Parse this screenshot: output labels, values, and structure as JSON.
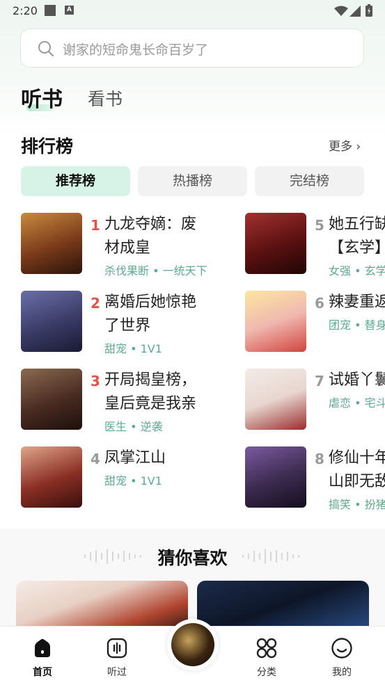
{
  "status": {
    "time": "2:20",
    "notification_badge": "A"
  },
  "search": {
    "placeholder": "谢家的短命鬼长命百岁了"
  },
  "top_tabs": [
    {
      "label": "听书",
      "active": true
    },
    {
      "label": "看书",
      "active": false
    }
  ],
  "ranking": {
    "title": "排行榜",
    "more": "更多 ›",
    "tabs": [
      {
        "label": "推荐榜",
        "active": true
      },
      {
        "label": "热播榜",
        "active": false
      },
      {
        "label": "完结榜",
        "active": false
      }
    ],
    "books": [
      {
        "rank": "1",
        "title_line1": "九龙夺嫡：废",
        "title_line2": "材成皇",
        "tags": "杀伐果断 • 一统天下",
        "cover_color": "#7a3a1a"
      },
      {
        "rank": "2",
        "title_line1": "离婚后她惊艳",
        "title_line2": "了世界",
        "tags": "甜宠 • 1V1",
        "cover_color": "#3a3b66"
      },
      {
        "rank": "3",
        "title_line1": "开局揭皇榜，",
        "title_line2": "皇后竟是我亲",
        "tags": "医生 • 逆袭",
        "cover_color": "#4a2b22"
      },
      {
        "rank": "4",
        "title_line1": "凤掌江山",
        "title_line2": "",
        "tags": "甜宠 • 1V1",
        "cover_color": "#8a2f24"
      },
      {
        "rank": "5",
        "title_line1": "她五行缺",
        "title_line2": "【玄学】",
        "tags": "女强 • 玄学",
        "cover_color": "#5a1010"
      },
      {
        "rank": "6",
        "title_line1": "辣妻重返",
        "title_line2": "",
        "tags": "团宠 • 替身",
        "cover_color": "#f0b9b0"
      },
      {
        "rank": "7",
        "title_line1": "试婚丫鬟",
        "title_line2": "",
        "tags": "虐恋 • 宅斗",
        "cover_color": "#e8d6cf"
      },
      {
        "rank": "8",
        "title_line1": "修仙十年",
        "title_line2": "山即无敌",
        "tags": "搞笑 • 扮猪",
        "cover_color": "#3b2a4e"
      }
    ],
    "rank_colors": {
      "top3": "#e4524d",
      "rest": "#9a9a9a"
    }
  },
  "guess": {
    "title": "猜你喜欢"
  },
  "bottom_nav": [
    {
      "label": "首页",
      "icon": "home-icon",
      "active": true
    },
    {
      "label": "听过",
      "icon": "history-icon",
      "active": false
    },
    {
      "label": "",
      "icon": "player-disc-icon",
      "active": false
    },
    {
      "label": "分类",
      "icon": "category-icon",
      "active": false
    },
    {
      "label": "我的",
      "icon": "profile-icon",
      "active": false
    }
  ],
  "colors": {
    "accent": "#5fa98d",
    "accent_light": "#d7f3e7"
  }
}
